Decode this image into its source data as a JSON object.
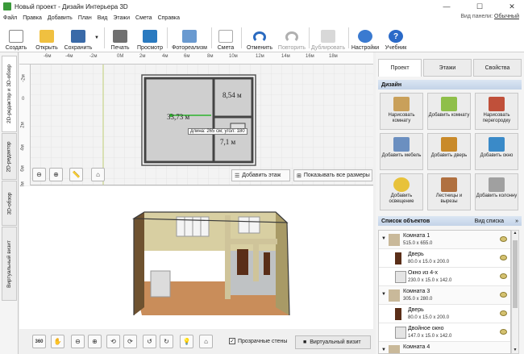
{
  "window": {
    "title": "Новый проект - Дизайн Интерьера 3D",
    "minimize": "—",
    "maximize": "☐",
    "close": "✕"
  },
  "menu": [
    "Файл",
    "Правка",
    "Добавить",
    "План",
    "Вид",
    "Этажи",
    "Смета",
    "Справка"
  ],
  "panel_view": {
    "label": "Вид панели:",
    "value": "Обычный"
  },
  "toolbar": {
    "create": "Создать",
    "open": "Открыть",
    "save": "Сохранить",
    "print": "Печать",
    "preview": "Просмотр",
    "photorealism": "Фотореализм",
    "estimate": "Смета",
    "undo": "Отменить",
    "redo": "Повторить",
    "duplicate": "Дублировать",
    "settings": "Настройки",
    "tutorial": "Учебник"
  },
  "side_tabs": [
    "2D-редактор и 3D-обзор",
    "2D-редактор",
    "3D-обзор",
    "Виртуальный визит"
  ],
  "ruler": {
    "top": [
      "-6м",
      "-4м",
      "-2м",
      "0М",
      "2м",
      "4м",
      "6м",
      "8м",
      "10м",
      "12м",
      "14м",
      "16м",
      "18м"
    ],
    "left": [
      "-2м",
      "0",
      "2м",
      "4м",
      "6м",
      "8м"
    ]
  },
  "plan": {
    "room1_area": "33,73 м",
    "room2_area": "8,54 м",
    "room3_area": "7,1 м",
    "tooltip": "длина: 265 см; угол: 180",
    "add_floor": "Добавить этаж",
    "show_all_sizes": "Показывать все размеры"
  },
  "bottom": {
    "transparent_walls": "Прозрачные стены",
    "virtual_visit": "Виртуальный визит",
    "rotate360": "360"
  },
  "right_tabs": [
    "Проект",
    "Этажи",
    "Свойства"
  ],
  "design": {
    "header": "Дизайн",
    "buttons": [
      {
        "label": "Нарисовать комнату",
        "color": "#c9a05a"
      },
      {
        "label": "Добавить комнату",
        "color": "#8fbf4a"
      },
      {
        "label": "Нарисовать перегородку",
        "color": "#c0503a"
      },
      {
        "label": "Добавить мебель",
        "color": "#6b8fc0"
      },
      {
        "label": "Добавить дверь",
        "color": "#c98a2a"
      },
      {
        "label": "Добавить окно",
        "color": "#3a8ac8"
      },
      {
        "label": "Добавить освещение",
        "color": "#e8c23a"
      },
      {
        "label": "Лестницы и вырезы",
        "color": "#b07040"
      },
      {
        "label": "Добавить колонну",
        "color": "#a0a0a0"
      }
    ]
  },
  "objects": {
    "header": "Список объектов",
    "view_list": "Вид списка",
    "items": [
      {
        "name": "Комната 1",
        "dims": "515.0 x 655.0",
        "child": false
      },
      {
        "name": "Дверь",
        "dims": "80.0 x 15.0 x 200.0",
        "child": true
      },
      {
        "name": "Окно из 4-х",
        "dims": "230.0 x 15.0 x 142.0",
        "child": true
      },
      {
        "name": "Комната 3",
        "dims": "305.0 x 280.0",
        "child": false
      },
      {
        "name": "Дверь",
        "dims": "80.0 x 15.0 x 200.0",
        "child": true
      },
      {
        "name": "Двойное окно",
        "dims": "147.0 x 15.0 x 142.0",
        "child": true
      },
      {
        "name": "Комната 4",
        "dims": "",
        "child": false
      }
    ]
  }
}
